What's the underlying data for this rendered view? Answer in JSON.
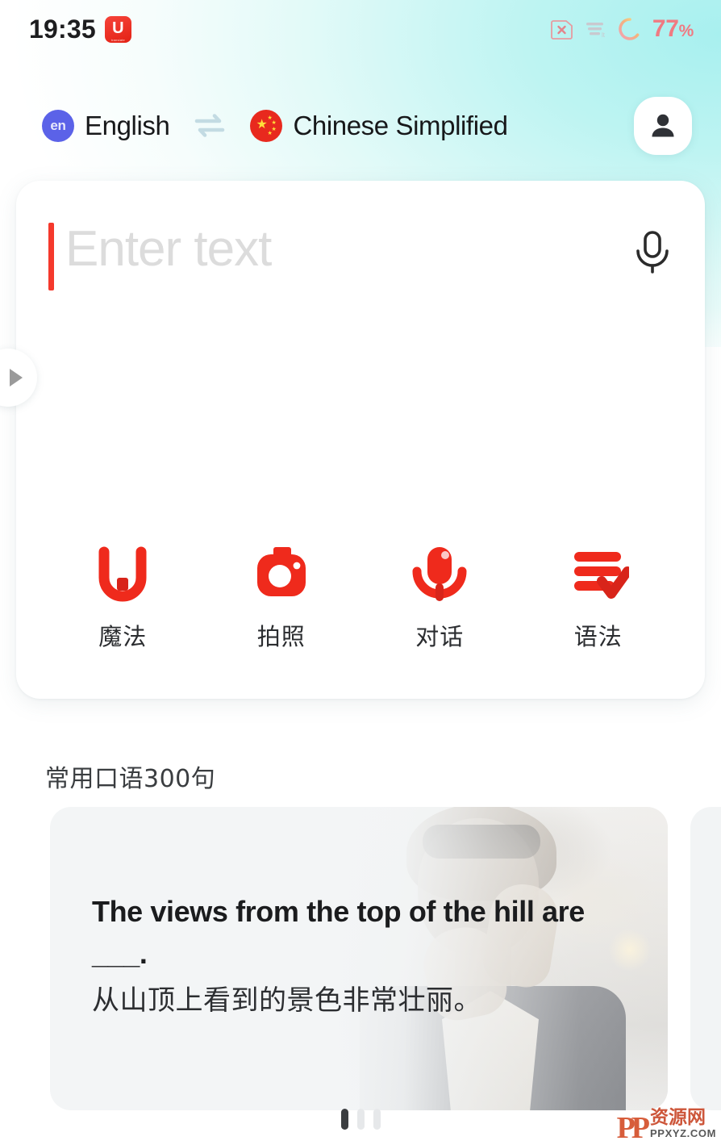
{
  "status_bar": {
    "time": "19:35",
    "app_badge_letter": "U",
    "app_badge_sub": "translate",
    "battery_percent": "77",
    "battery_percent_symbol": "%",
    "icons": [
      "sim-card-x-icon",
      "signal-lt-icon",
      "battery-ring-icon"
    ],
    "accent_color": "#f07a82"
  },
  "language_bar": {
    "source": {
      "code": "en",
      "label": "English",
      "flag": "flag-en-icon"
    },
    "target": {
      "code": "zh",
      "label": "Chinese Simplified",
      "flag": "flag-cn-icon"
    },
    "swap_icon": "swap-arrows-icon",
    "avatar_icon": "person-icon"
  },
  "input_card": {
    "placeholder": "Enter text",
    "value": "",
    "mic_icon": "microphone-icon",
    "caret_color": "#f5392c"
  },
  "quick_actions": [
    {
      "label": "魔法",
      "icon": "magic-u-icon",
      "color": "#ef2a1c"
    },
    {
      "label": "拍照",
      "icon": "camera-icon",
      "color": "#ef2a1c"
    },
    {
      "label": "对话",
      "icon": "conversation-mic-icon",
      "color": "#ef2a1c"
    },
    {
      "label": "语法",
      "icon": "grammar-check-icon",
      "color": "#ef2a1c"
    }
  ],
  "edge_handle": {
    "icon": "play-arrow-right-icon"
  },
  "phrases_section": {
    "title": "常用口语300句",
    "cards": [
      {
        "english": "The views from the top of the hill are ___.",
        "chinese": "从山顶上看到的景色非常壮丽。"
      }
    ]
  },
  "bottom": {
    "page_dots_total": 3,
    "page_dots_active_index": 0
  },
  "watermark": {
    "logo": "PP",
    "brand_cn": "资源网",
    "url": "PPXYZ.COM"
  }
}
